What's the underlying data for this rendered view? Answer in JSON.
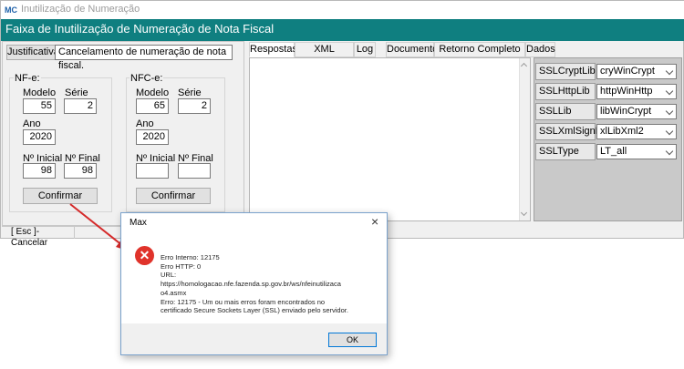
{
  "window": {
    "title": "Inutilização de Numeração",
    "icon": "app-logo-icon",
    "icon_text": "MC"
  },
  "banner": {
    "title": "Faixa de Inutilização de Numeração de Nota Fiscal"
  },
  "justificativa": {
    "label": "Justificativa",
    "value": "Cancelamento de numeração de nota fiscal."
  },
  "nfe": {
    "title": "NF-e:",
    "modelo_label": "Modelo",
    "modelo": "55",
    "serie_label": "Série",
    "serie": "2",
    "ano_label": "Ano",
    "ano": "2020",
    "inicial_label": "Nº Inicial",
    "inicial": "98",
    "final_label": "Nº Final",
    "final": "98",
    "confirm": "Confirmar"
  },
  "nfce": {
    "title": "NFC-e:",
    "modelo_label": "Modelo",
    "modelo": "65",
    "serie_label": "Série",
    "serie": "2",
    "ano_label": "Ano",
    "ano": "2020",
    "inicial_label": "Nº Inicial",
    "inicial": "",
    "final_label": "Nº Final",
    "final": "",
    "confirm": "Confirmar"
  },
  "status": {
    "cancel": "[ Esc ]-Cancelar"
  },
  "tabs": [
    "Respostas",
    "XML Resposta",
    "Log",
    "Documento",
    "Retorno Completo WS",
    "Dados"
  ],
  "config": [
    {
      "label": "SSLCryptLib",
      "value": "cryWinCrypt"
    },
    {
      "label": "SSLHttpLib",
      "value": "httpWinHttp"
    },
    {
      "label": "SSLLib",
      "value": "libWinCrypt"
    },
    {
      "label": "SSLXmlSignLib",
      "value": "xlLibXml2"
    },
    {
      "label": "SSLType",
      "value": "LT_all"
    }
  ],
  "dialog": {
    "title": "Max",
    "message": "Erro Interno: 12175\nErro HTTP: 0\nURL:\nhttps://homologacao.nfe.fazenda.sp.gov.br/ws/nfeinutilizaca\no4.asmx\nErro: 12175 - Um ou mais erros foram encontrados no\ncertificado Secure Sockets Layer (SSL) enviado pelo servidor.",
    "ok": "OK",
    "close_icon": "close-icon",
    "error_icon": "error-icon"
  },
  "colors": {
    "banner": "#0f7f80",
    "error": "#e0332b",
    "annotation_arrow": "#d52a2a"
  }
}
